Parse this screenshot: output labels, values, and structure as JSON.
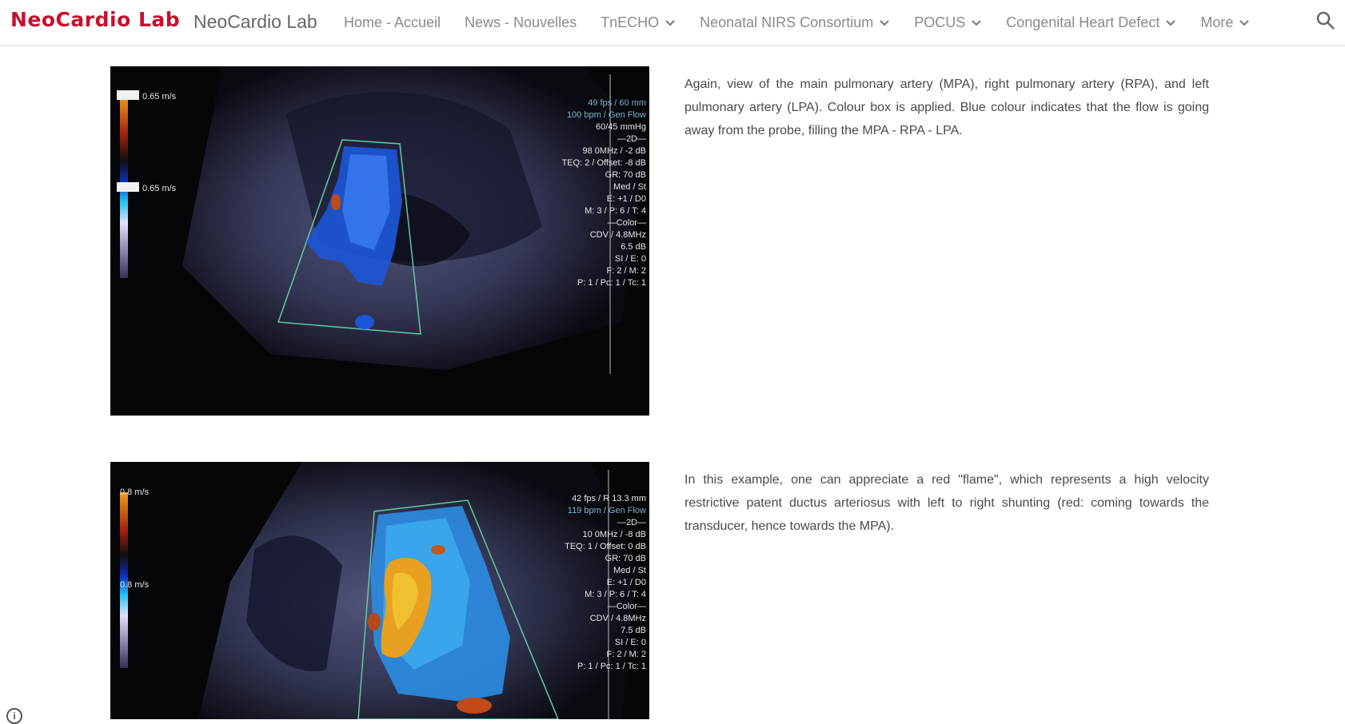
{
  "header": {
    "brand_logo": "NeoCardio Lab",
    "site_title": "NeoCardio Lab",
    "nav": [
      {
        "label": "Home - Accueil",
        "has_menu": false
      },
      {
        "label": "News - Nouvelles",
        "has_menu": false
      },
      {
        "label": "TnECHO",
        "has_menu": true
      },
      {
        "label": "Neonatal NIRS Consortium",
        "has_menu": true
      },
      {
        "label": "POCUS",
        "has_menu": true
      },
      {
        "label": "Congenital Heart Defect",
        "has_menu": true
      },
      {
        "label": "More",
        "has_menu": true
      }
    ],
    "search_icon": "search-icon",
    "brand_color": "#c8102e"
  },
  "sections": [
    {
      "caption": "Again, view of the main pulmonary artery (MPA), right pulmonary artery (RPA), and left pulmonary artery (LPA). Colour box is applied. Blue colour indicates that the flow is going away from the probe, filling the MPA - RPA - LPA.",
      "image": {
        "scale_top": "0.65 m/s",
        "scale_bottom": "0.65 m/s",
        "settings": [
          "49 fps / 60 mm",
          "100 bpm / Gen Flow",
          "60/45 mmHg",
          "—2D—",
          "98 0MHz / -2 dB",
          "TEQ: 2 / Offset: -8 dB",
          "GR: 70 dB",
          "Med / St",
          "E: +1 / D0",
          "M: 3 / P: 6 / T: 4",
          "—Color—",
          "CDV / 4.8MHz",
          "6.5 dB",
          "SI / E: 0",
          "F: 2 / M: 2",
          "P: 1 / Pc: 1 / Tc: 1"
        ]
      }
    },
    {
      "caption": "In this example, one can appreciate a red \"flame\", which represents a high velocity restrictive patent ductus arteriosus with left to right shunting (red: coming towards the transducer, hence towards the MPA).",
      "image": {
        "scale_top": "0.8 m/s",
        "scale_bottom": "0.8 m/s",
        "settings": [
          "42 fps / R 13.3 mm",
          "119 bpm / Gen Flow",
          "—2D—",
          "10 0MHz / -8 dB",
          "TEQ: 1 / Offset: 0 dB",
          "GR: 70 dB",
          "Med / St",
          "E: +1 / D0",
          "M: 3 / P: 6 / T: 4",
          "—Color—",
          "CDV / 4.8MHz",
          "7.5 dB",
          "SI / E: 0",
          "F: 2 / M: 2",
          "P: 1 / Pc: 1 / Tc: 1"
        ]
      }
    }
  ],
  "footer": {
    "info_icon": "info-icon",
    "info_glyph": "i"
  }
}
